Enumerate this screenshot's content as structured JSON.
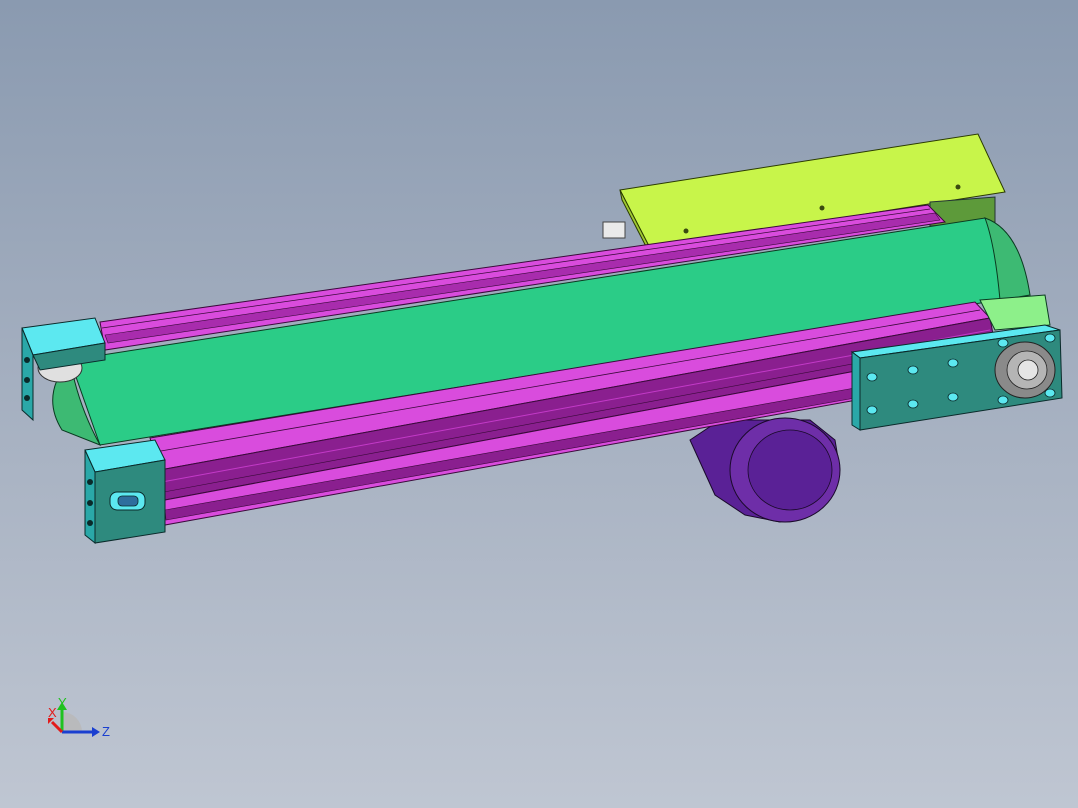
{
  "viewport": {
    "background_top": "#8a9ab0",
    "background_bottom": "#bfc6d2"
  },
  "model": {
    "parts": [
      {
        "name": "conveyor-belt",
        "color": "#2bcc87"
      },
      {
        "name": "side-rail-profile",
        "color": "#d94cdd"
      },
      {
        "name": "side-rail-profile-dark",
        "color": "#8a1f8f"
      },
      {
        "name": "end-block",
        "color": "#5ce8f0"
      },
      {
        "name": "end-plate",
        "color": "#2e8a7e"
      },
      {
        "name": "motor-cover",
        "color": "#c8f54a"
      },
      {
        "name": "gear-motor",
        "color": "#6e2ea8"
      },
      {
        "name": "drive-pulley",
        "color": "#3dba73"
      }
    ]
  },
  "triad": {
    "x_label": "X",
    "y_label": "Y",
    "z_label": "Z",
    "x_color": "#e21b1b",
    "y_color": "#1fc21f",
    "z_color": "#1a3fd0"
  }
}
